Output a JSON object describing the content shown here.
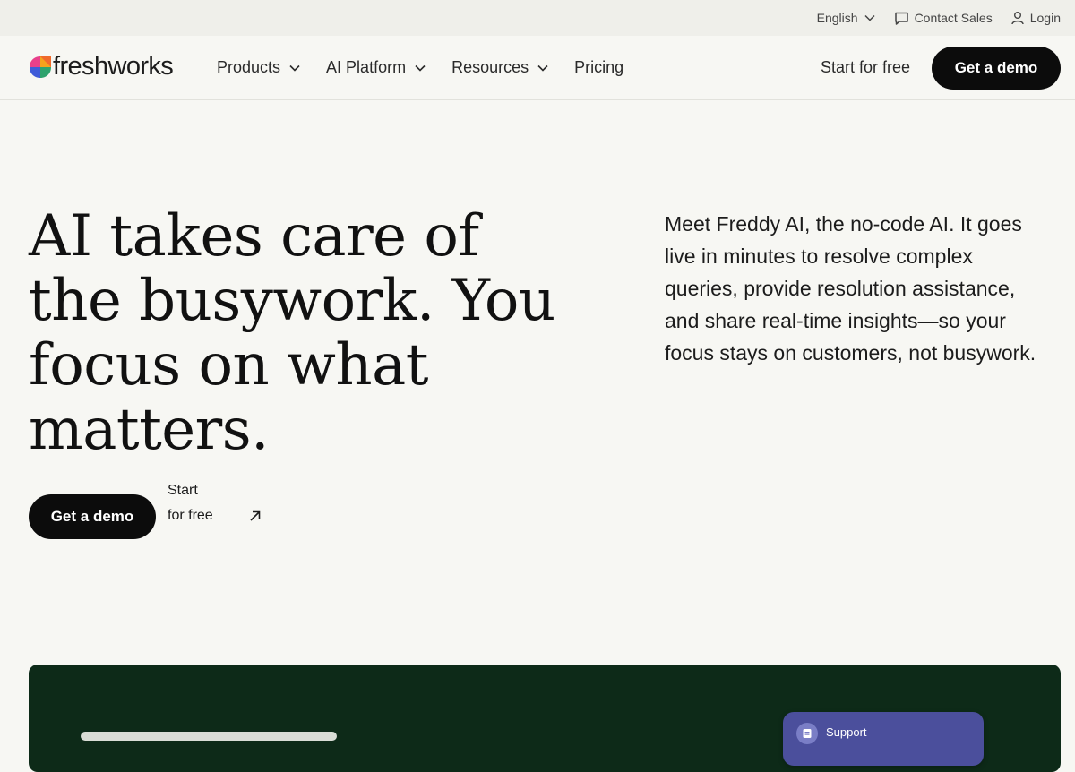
{
  "utility_bar": {
    "language": "English",
    "contact_sales": "Contact Sales",
    "login": "Login"
  },
  "header": {
    "logo_text": "freshworks",
    "nav": [
      {
        "label": "Products",
        "has_dropdown": true
      },
      {
        "label": "AI Platform",
        "has_dropdown": true
      },
      {
        "label": "Resources",
        "has_dropdown": true
      },
      {
        "label": "Pricing",
        "has_dropdown": false
      }
    ],
    "start_free": "Start for free",
    "get_demo": "Get a demo"
  },
  "hero": {
    "title_lines": [
      "AI takes care of",
      "the busywork. You",
      "focus on what",
      "matters."
    ],
    "description": "Meet Freddy AI, the no-code AI. It goes live in minutes to resolve complex queries, provide resolution assistance, and share real-time insights—so your focus stays on customers, not busywork.",
    "get_demo": "Get a demo",
    "start_free": "Start for free"
  },
  "preview_panel": {
    "support_label": "Support"
  },
  "colors": {
    "background": "#f7f7f3",
    "utility_bar": "#efefea",
    "button_dark": "#0c0c0c",
    "panel_green": "#0d2a18",
    "support_card": "#4b4f9c"
  },
  "icons": [
    "chevron-down-icon",
    "chat-bubble-icon",
    "user-icon",
    "arrow-up-right-icon",
    "freshworks-logo-mark",
    "document-icon"
  ]
}
